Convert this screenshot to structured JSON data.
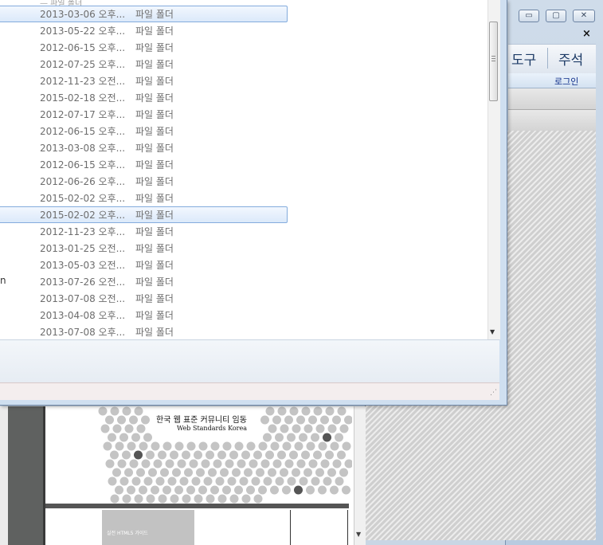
{
  "background_window": {
    "window_buttons": {
      "minimize": "▭",
      "maximize": "▢",
      "close": "✕"
    },
    "panel_close": "×",
    "tabs": [
      "도구",
      "주석"
    ],
    "login_label": "로그인",
    "document": {
      "title": "한국 웹 표준 커뮤니티 임동",
      "subtitle": "Web Standards Korea",
      "section_label": "실전 HTML5 가이드"
    }
  },
  "file_list": {
    "top_clip": "— 파일 폴더",
    "rows": [
      {
        "name": "",
        "date": "2013-03-06 오후...",
        "type": "파일 폴더",
        "selected": true
      },
      {
        "name": "",
        "date": "2013-05-22 오후...",
        "type": "파일 폴더"
      },
      {
        "name": "",
        "date": "2012-06-15 오후...",
        "type": "파일 폴더"
      },
      {
        "name": "",
        "date": "2012-07-25 오후...",
        "type": "파일 폴더"
      },
      {
        "name": "",
        "date": "2012-11-23 오전...",
        "type": "파일 폴더"
      },
      {
        "name": "",
        "date": "2015-02-18 오전...",
        "type": "파일 폴더"
      },
      {
        "name": "",
        "date": "2012-07-17 오후...",
        "type": "파일 폴더"
      },
      {
        "name": "",
        "date": "2012-06-15 오후...",
        "type": "파일 폴더"
      },
      {
        "name": "",
        "date": "2013-03-08 오후...",
        "type": "파일 폴더"
      },
      {
        "name": "",
        "date": "2012-06-15 오후...",
        "type": "파일 폴더"
      },
      {
        "name": "",
        "date": "2012-06-26 오후...",
        "type": "파일 폴더"
      },
      {
        "name": "",
        "date": "2015-02-02 오후...",
        "type": "파일 폴더"
      },
      {
        "name": "",
        "date": "2015-02-02 오후...",
        "type": "파일 폴더",
        "selected": true
      },
      {
        "name": "",
        "date": "2012-11-23 오후...",
        "type": "파일 폴더"
      },
      {
        "name": "",
        "date": "2013-01-25 오전...",
        "type": "파일 폴더"
      },
      {
        "name": "",
        "date": "2013-05-03 오전...",
        "type": "파일 폴더"
      },
      {
        "name": "n",
        "date": "2013-07-26 오전...",
        "type": "파일 폴더"
      },
      {
        "name": "",
        "date": "2013-07-08 오전...",
        "type": "파일 폴더"
      },
      {
        "name": "",
        "date": "2013-04-08 오후...",
        "type": "파일 폴더"
      },
      {
        "name": "",
        "date": "2013-07-08 오후...",
        "type": "파일 폴더"
      }
    ]
  },
  "scrollbar": {
    "down_arrow": "▼"
  },
  "resize_grip": "⋰"
}
